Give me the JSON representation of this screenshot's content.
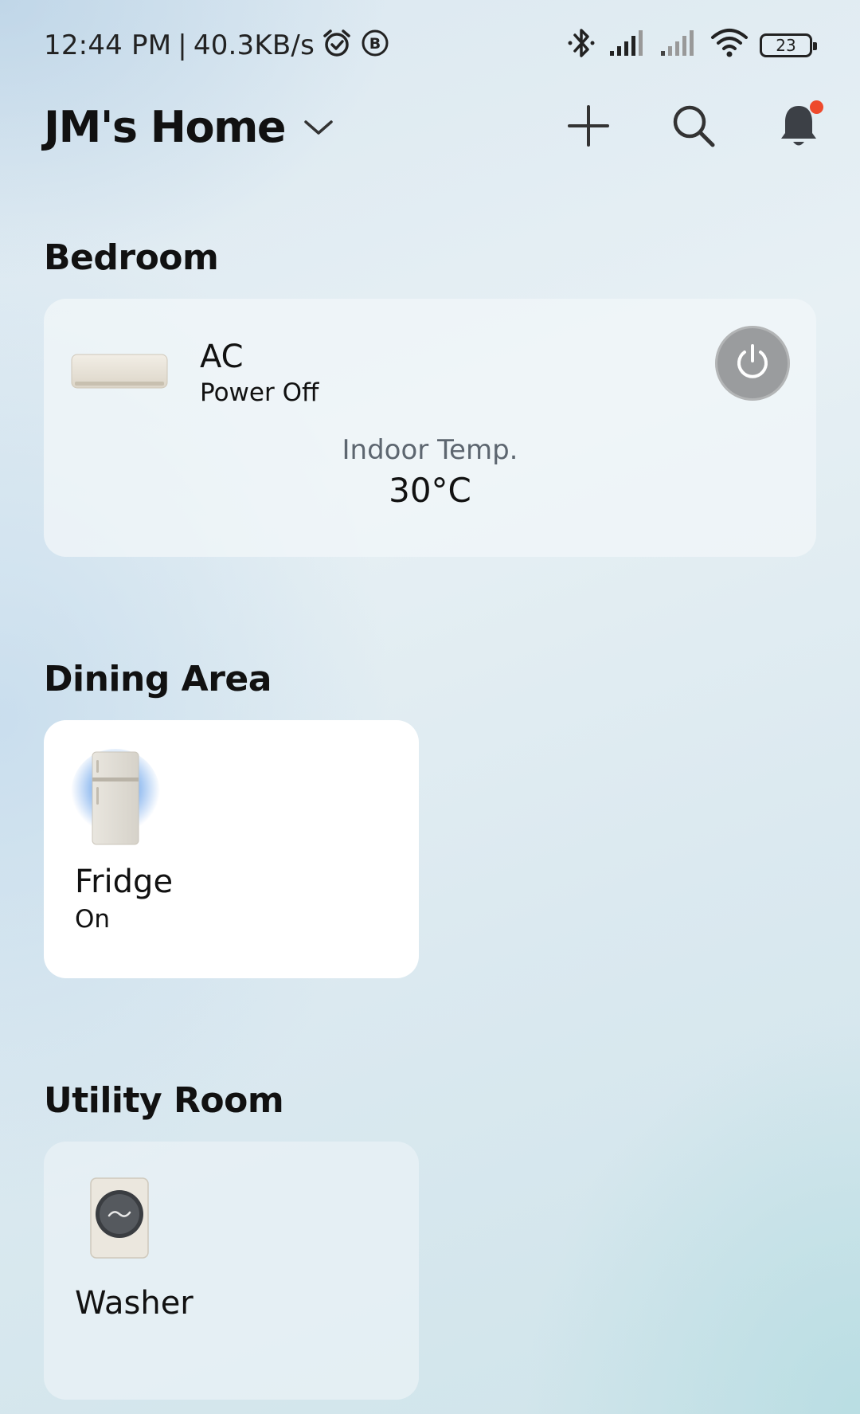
{
  "status_bar": {
    "time": "12:44 PM",
    "separator": "|",
    "net_speed": "40.3KB/s",
    "battery": "23"
  },
  "header": {
    "home_name": "JM's Home"
  },
  "sections": [
    {
      "title": "Bedroom",
      "device": {
        "name": "AC",
        "status": "Power Off",
        "temp_label": "Indoor Temp.",
        "temp_value": "30°C"
      }
    },
    {
      "title": "Dining Area",
      "device": {
        "name": "Fridge",
        "status": "On"
      }
    },
    {
      "title": "Utility Room",
      "device": {
        "name": "Washer"
      }
    }
  ],
  "colors": {
    "notification_dot": "#ee4a2c",
    "power_button": "#9a9c9e",
    "fridge_glow": "#4a8fe6"
  },
  "icons": {
    "add": "plus-icon",
    "search": "search-icon",
    "notifications": "bell-icon",
    "power": "power-icon",
    "dropdown": "chevron-down-icon"
  }
}
